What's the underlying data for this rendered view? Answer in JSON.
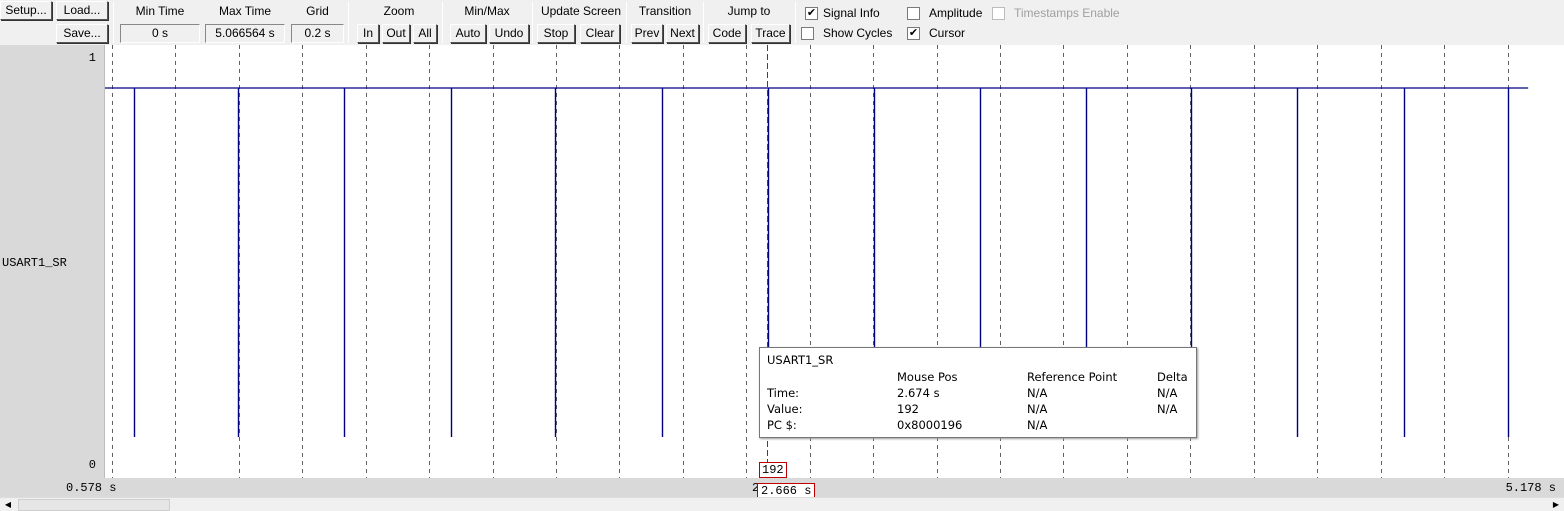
{
  "toolbar": {
    "setup_label": "Setup...",
    "load_label": "Load...",
    "save_label": "Save...",
    "min_time": {
      "label": "Min Time",
      "value": "0 s"
    },
    "max_time": {
      "label": "Max Time",
      "value": "5.066564 s"
    },
    "grid": {
      "label": "Grid",
      "value": "0.2 s"
    },
    "zoom": {
      "label": "Zoom",
      "in": "In",
      "out": "Out",
      "all": "All"
    },
    "minmax": {
      "label": "Min/Max",
      "auto": "Auto",
      "undo": "Undo"
    },
    "update_screen": {
      "label": "Update Screen",
      "stop": "Stop",
      "clear": "Clear"
    },
    "transition": {
      "label": "Transition",
      "prev": "Prev",
      "next": "Next"
    },
    "jump_to": {
      "label": "Jump to",
      "code": "Code",
      "trace": "Trace"
    },
    "checkboxes": {
      "signal_info": {
        "label": "Signal Info",
        "checked": true
      },
      "amplitude": {
        "label": "Amplitude",
        "checked": false
      },
      "timestamps_enable": {
        "label": "Timestamps Enable",
        "checked": false,
        "disabled": true
      },
      "show_cycles": {
        "label": "Show Cycles",
        "checked": false
      },
      "cursor": {
        "label": "Cursor",
        "checked": true
      }
    }
  },
  "signal": {
    "name": "USART1_SR",
    "y_max_label": "1",
    "y_min_label": "0"
  },
  "time_axis": {
    "start_label": "0.578 s",
    "end_label": "5.178 s",
    "mid_digit": "2",
    "cursor_time": "2.666 s",
    "cursor_value": "192"
  },
  "chart_data": {
    "type": "line",
    "x_range_s": [
      0.578,
      5.178
    ],
    "grid_step_s": 0.2,
    "y_range": [
      0,
      1
    ],
    "signal": "USART1_SR",
    "high_level": 1,
    "low_level": 0,
    "pulse_low_times_s": [
      0.668,
      0.998,
      1.333,
      1.668,
      1.998,
      2.333,
      2.668,
      3.003,
      3.337,
      3.672,
      4.003,
      4.337,
      4.672,
      5.002
    ],
    "cursor_time_s": 2.666,
    "colors": {
      "trace": "#000080",
      "grid": "#606060",
      "cursor": "#1f3fbf"
    }
  },
  "tooltip": {
    "title": "USART1_SR",
    "col_mouse": "Mouse Pos",
    "col_ref": "Reference Point",
    "col_delta": "Delta",
    "rows": [
      {
        "label": "Time:",
        "mouse": "2.674 s",
        "ref": "N/A",
        "delta": "N/A"
      },
      {
        "label": "Value:",
        "mouse": "192",
        "ref": "N/A",
        "delta": "N/A"
      },
      {
        "label": "PC $:",
        "mouse": "0x8000196",
        "ref": "N/A",
        "delta": ""
      }
    ]
  },
  "icons": {
    "scroll_left": "left-arrow-icon",
    "scroll_right": "right-arrow-icon"
  }
}
